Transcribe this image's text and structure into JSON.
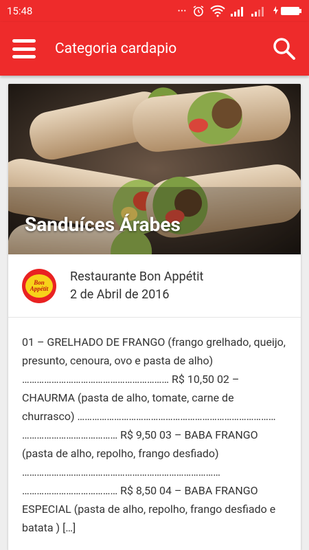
{
  "status_bar": {
    "time": "15:48"
  },
  "app_bar": {
    "title": "Categoria cardapio"
  },
  "post": {
    "title": "Sanduíces Árabes",
    "author": "Restaurante Bon Appétit",
    "date": "2 de Abril de 2016",
    "logo_line1": "Bon",
    "logo_line2": "Appétit",
    "body": "01 – GRELHADO DE FRANGO (frango grelhado, queijo, presunto, cenoura, ovo e pasta de alho) …………………………………………………… R$ 10,50 02 – CHAURMA  (pasta de alho, tomate, carne de churrasco) ……………………………………………………………………… ………………………………… R$ 9,50 03 – BABA FRANGO (pasta de alho, repolho, frango desfiado) ……………………………………………………………………… ………………………………… R$ 8,50 04 – BABA FRANGO ESPECIAL (pasta de alho, repolho, frango desfiado e batata ) […]"
  },
  "colors": {
    "primary": "#ee2b2b",
    "card": "#ffffff",
    "background": "#eeeeee"
  },
  "icons": [
    "alarm-icon",
    "wifi-icon",
    "signal-icon",
    "battery-icon",
    "menu-icon",
    "search-icon"
  ]
}
